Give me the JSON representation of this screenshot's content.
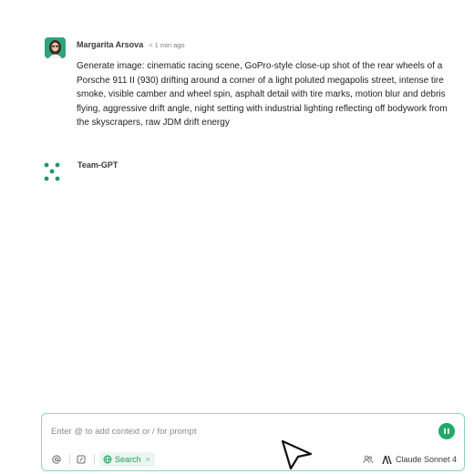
{
  "user_message": {
    "author": "Margarita Arsova",
    "timestamp": "< 1 min ago",
    "text": "Generate image: cinematic racing scene, GoPro-style close-up shot of the rear wheels of a Porsche 911 II (930) drifting around a corner of a light poluted megapolis street, intense tire smoke, visible camber and wheel spin, asphalt detail with tire marks, motion blur and debris flying, aggressive drift angle, night setting with industrial lighting reflecting off bodywork from the skyscrapers, raw JDM drift energy"
  },
  "assistant_message": {
    "name": "Team-GPT",
    "icon": "team-gpt-loading-dots-icon"
  },
  "composer": {
    "placeholder": "Enter @ to add context or / for prompt",
    "value": "",
    "send_icon": "send-icon",
    "toolbar": {
      "mention_icon": "at-sign-icon",
      "prompt_icon": "slash-command-icon",
      "search_chip": {
        "label": "Search",
        "close": "×",
        "icon": "globe-icon"
      },
      "people_icon": "users-icon",
      "model": {
        "label": "Claude Sonnet 4",
        "icon": "anthropic-logo-icon"
      }
    }
  },
  "colors": {
    "accent": "#22a86c",
    "composer_border": "#8fd4b7",
    "chip_background": "#eaf6ef"
  }
}
